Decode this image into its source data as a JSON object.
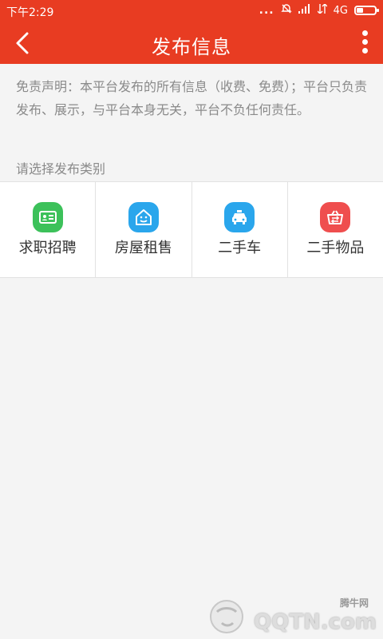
{
  "status_bar": {
    "time": "下午2:29",
    "dots": "...",
    "network": "4G",
    "icons": [
      "alarm-off-icon",
      "signal-icon",
      "signal-icon",
      "battery-icon"
    ]
  },
  "app_bar": {
    "title": "发布信息",
    "back_icon": "back-arrow-icon",
    "more_icon": "more-vert-icon",
    "background": "#e83c22"
  },
  "disclaimer": "免责声明：本平台发布的所有信息（收费、免费）；平台只负责发布、展示，与平台本身无关，平台不负任何责任。",
  "section_label": "请选择发布类别",
  "categories": [
    {
      "label": "求职招聘",
      "icon": "id-card-icon",
      "color": "#3cc15a"
    },
    {
      "label": "房屋租售",
      "icon": "house-icon",
      "color": "#2aa6ec"
    },
    {
      "label": "二手车",
      "icon": "car-icon",
      "color": "#2aa6ec"
    },
    {
      "label": "二手物品",
      "icon": "basket-icon",
      "color": "#ef4e4e"
    }
  ],
  "watermark": {
    "text": "QQTN.com",
    "subtext": "腾牛网"
  }
}
